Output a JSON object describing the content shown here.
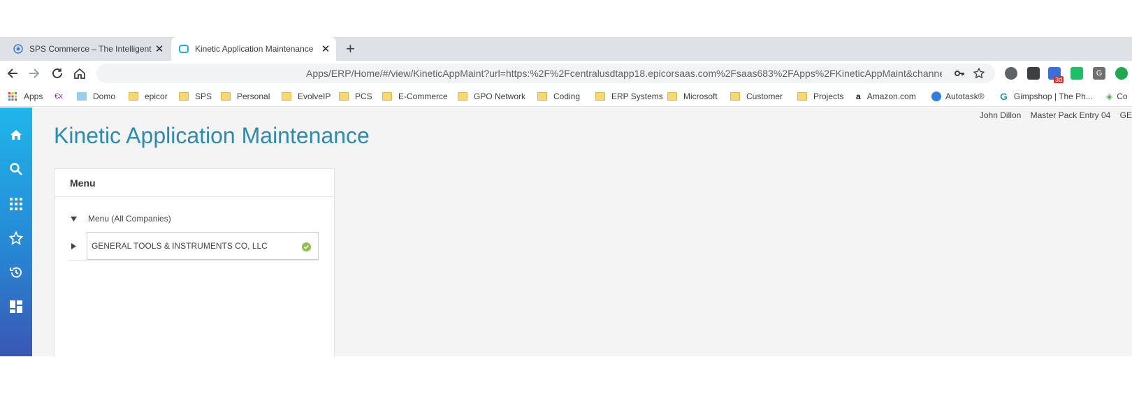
{
  "browser": {
    "tabs": [
      {
        "title": "SPS Commerce – The Intelligent R",
        "active": false
      },
      {
        "title": "Kinetic Application Maintenance",
        "active": true
      }
    ],
    "close_glyph": "✕",
    "new_tab_glyph": "+",
    "address_text": "Apps/ERP/Home/#/view/KineticAppMaint?url=https:%2F%2Fcentralusdtapp18.epicorsaas.com%2Fsaas683%2FApps%2FKineticAppMaint&channell...",
    "extension_badge": "3d",
    "extension_letter": "G"
  },
  "bookmarks": [
    {
      "label": "Apps",
      "icon": "apps-grid-icon"
    },
    {
      "label": "",
      "icon": "ex-icon",
      "glyph": "€x"
    },
    {
      "label": "Domo",
      "icon": "domo-icon"
    },
    {
      "label": "epicor",
      "icon": "folder-icon"
    },
    {
      "label": "SPS",
      "icon": "folder-icon"
    },
    {
      "label": "Personal",
      "icon": "folder-icon"
    },
    {
      "label": "EvolveIP",
      "icon": "folder-icon"
    },
    {
      "label": "PCS",
      "icon": "folder-icon"
    },
    {
      "label": "E-Commerce",
      "icon": "folder-icon"
    },
    {
      "label": "GPO Network",
      "icon": "folder-icon"
    },
    {
      "label": "Coding",
      "icon": "folder-icon"
    },
    {
      "label": "ERP Systems",
      "icon": "folder-icon"
    },
    {
      "label": "Microsoft",
      "icon": "folder-icon"
    },
    {
      "label": "Customer",
      "icon": "folder-icon"
    },
    {
      "label": "Projects",
      "icon": "folder-icon"
    },
    {
      "label": "Amazon.com",
      "icon": "amazon-icon",
      "glyph": "a"
    },
    {
      "label": "Autotask®",
      "icon": "autotask-icon"
    },
    {
      "label": "Gimpshop | The Ph...",
      "icon": "gimpshop-icon",
      "glyph": "G"
    },
    {
      "label": "Co",
      "icon": "co-icon",
      "glyph": "◈"
    }
  ],
  "app": {
    "user_name": "John Dillon",
    "workstation": "Master Pack Entry 04",
    "company_short": "GE",
    "page_title": "Kinetic Application Maintenance",
    "menu_panel": {
      "title": "Menu",
      "tree": [
        {
          "label": "Menu (All Companies)",
          "expanded": true
        },
        {
          "label": "GENERAL TOOLS & INSTRUMENTS CO, LLC",
          "expanded": false,
          "selected": true,
          "status": "ok"
        }
      ]
    }
  },
  "colors": {
    "title_blue": "#2f8ab0",
    "rail_top": "#1fb6ea",
    "rail_bottom": "#3a57b5",
    "status_ok": "#8bc34a"
  }
}
